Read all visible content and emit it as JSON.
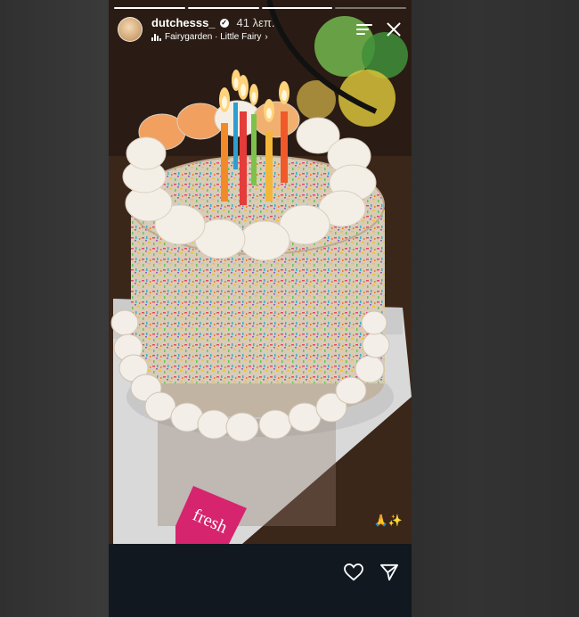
{
  "story": {
    "username": "dutchesss_",
    "time": "41 λεπ.",
    "music": "Fairygarden · Little Fairy",
    "music_chevron": "›",
    "sticker_text": "🙏✨",
    "cake_box_text": "fresh",
    "progress": {
      "total": 4,
      "current": 3
    }
  },
  "colors": {
    "background": "#2a2a2a",
    "footer": "#111820",
    "accent_pink": "#d6246e"
  },
  "icons": {
    "menu": "menu-icon",
    "close": "close-icon",
    "heart": "heart-icon",
    "share": "send-icon",
    "verified": "verified-badge-icon",
    "music": "audio-bars-icon"
  }
}
